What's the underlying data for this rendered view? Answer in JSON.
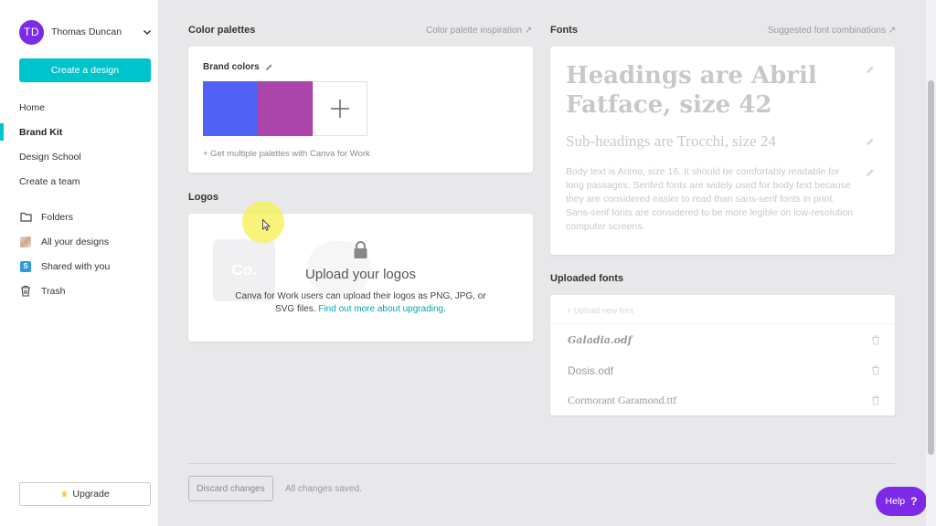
{
  "user": {
    "initials": "TD",
    "name": "Thomas Duncan"
  },
  "sidebar": {
    "create_label": "Create a design",
    "nav": [
      {
        "label": "Home"
      },
      {
        "label": "Brand Kit"
      },
      {
        "label": "Design School"
      },
      {
        "label": "Create a team"
      }
    ],
    "nav2": [
      {
        "label": "Folders",
        "icon": "folder-icon"
      },
      {
        "label": "All your designs",
        "icon": "designs-thumb-icon"
      },
      {
        "label": "Shared with you",
        "icon": "shared-icon"
      },
      {
        "label": "Trash",
        "icon": "trash-icon"
      }
    ],
    "shared_icon_letter": "S",
    "upgrade_label": "Upgrade"
  },
  "palettes": {
    "title": "Color palettes",
    "inspiration_link": "Color palette inspiration ↗",
    "brand_colors_title": "Brand colors",
    "swatches": [
      "#5160f5",
      "#ac45ab"
    ],
    "note": "+ Get multiple palettes with Canva for Work"
  },
  "logos": {
    "title": "Logos",
    "ghost_text": "Co.",
    "upload_title": "Upload your logos",
    "upload_desc": "Canva for Work users can upload their logos as PNG, JPG, or SVG files.",
    "upload_link": "Find out more about upgrading."
  },
  "fonts": {
    "title": "Fonts",
    "suggested_link": "Suggested font combinations ↗",
    "heading_sample": "Headings are Abril Fatface, size 42",
    "subheading_sample": "Sub-headings are Trocchi, size 24",
    "body_sample": "Body text is Arimo, size 16. It should be comfortably readable for long passages. Serifed fonts are widely used for body text because they are considered easier to read than sans-serif fonts in print. Sans-serif fonts are considered to be more legible on low-resolution computer screens."
  },
  "uploaded_fonts": {
    "title": "Uploaded fonts",
    "upload_new": "+ Upload new font",
    "items": [
      {
        "name": "Galadia.odf"
      },
      {
        "name": "Dosis.odf"
      },
      {
        "name": "Cormorant Garamond.ttf"
      }
    ]
  },
  "footer": {
    "discard_label": "Discard changes",
    "saved_text": "All changes saved."
  },
  "help": {
    "label": "Help",
    "icon": "?"
  },
  "colors": {
    "accent": "#00c4cc",
    "avatar": "#7d2ae8",
    "help": "#7d2ae8"
  }
}
